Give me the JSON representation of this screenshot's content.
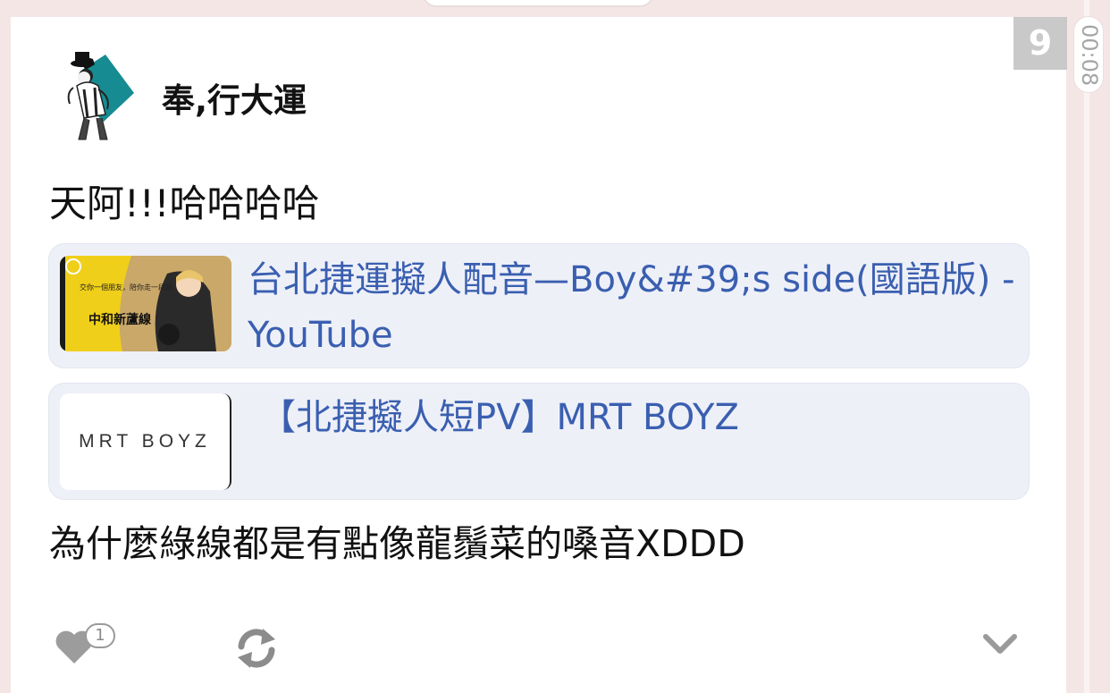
{
  "timestamp": "00:08",
  "badge": "9",
  "post": {
    "author": "奉,行大運",
    "text1": "天阿!!!哈哈哈哈",
    "text2": "為什麼綠線都是有點像龍鬚菜的嗓音XDDD"
  },
  "link_cards": [
    {
      "title": "台北捷運擬人配音—Boy&#39;s side(國語版) - YouTube",
      "thumb_caption_line1": "交你一個朋友，陪你走一段路",
      "thumb_caption_line2": "中和新蘆線"
    },
    {
      "title": "【北捷擬人短PV】MRT BOYZ",
      "thumb_text": "MRT BOYZ"
    }
  ],
  "actions": {
    "like_count": "1",
    "icons": [
      "heart-icon",
      "repost-icon",
      "chevron-down-icon"
    ]
  },
  "colors": {
    "link": "#3a5fb0",
    "background": "#f5e6e6",
    "card": "#eef0f8",
    "badge": "#c9c9c9"
  }
}
